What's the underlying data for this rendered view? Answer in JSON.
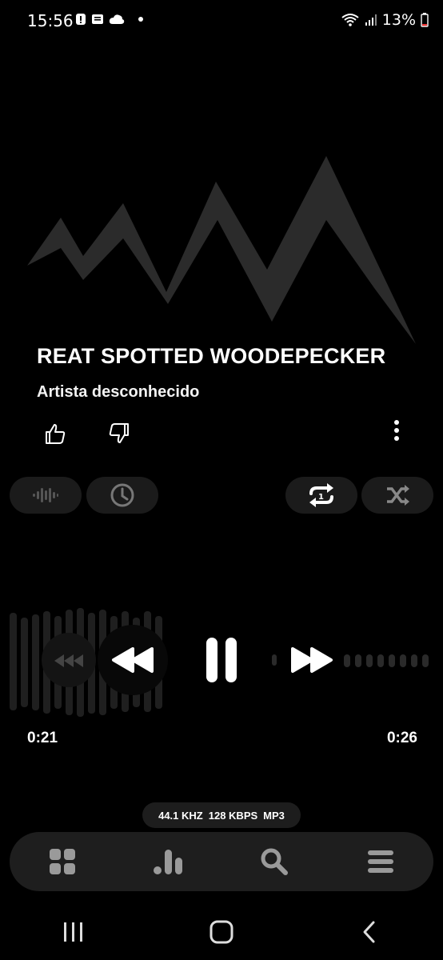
{
  "status_bar": {
    "time": "15:56",
    "battery": "13%",
    "icons": [
      "alert-icon",
      "message-icon",
      "cloud-icon",
      "dot-icon",
      "wifi-icon",
      "signal-icon",
      "battery-icon"
    ]
  },
  "track": {
    "title": "REAT SPOTTED WOODEPECKER",
    "artist": "Artista desconhecido"
  },
  "playback": {
    "elapsed": "0:21",
    "remaining": "0:26"
  },
  "format": {
    "sample_rate": "44.1 KHZ",
    "bitrate": "128 KBPS",
    "codec": "MP3"
  },
  "bottom_nav": {
    "items": [
      "grid-icon",
      "bars-icon",
      "search-icon",
      "menu-icon"
    ]
  },
  "colors": {
    "background": "#000000",
    "pill": "#1b1b1b",
    "bar": "#1e1e1e",
    "art_gray": "#2b2b2b"
  }
}
